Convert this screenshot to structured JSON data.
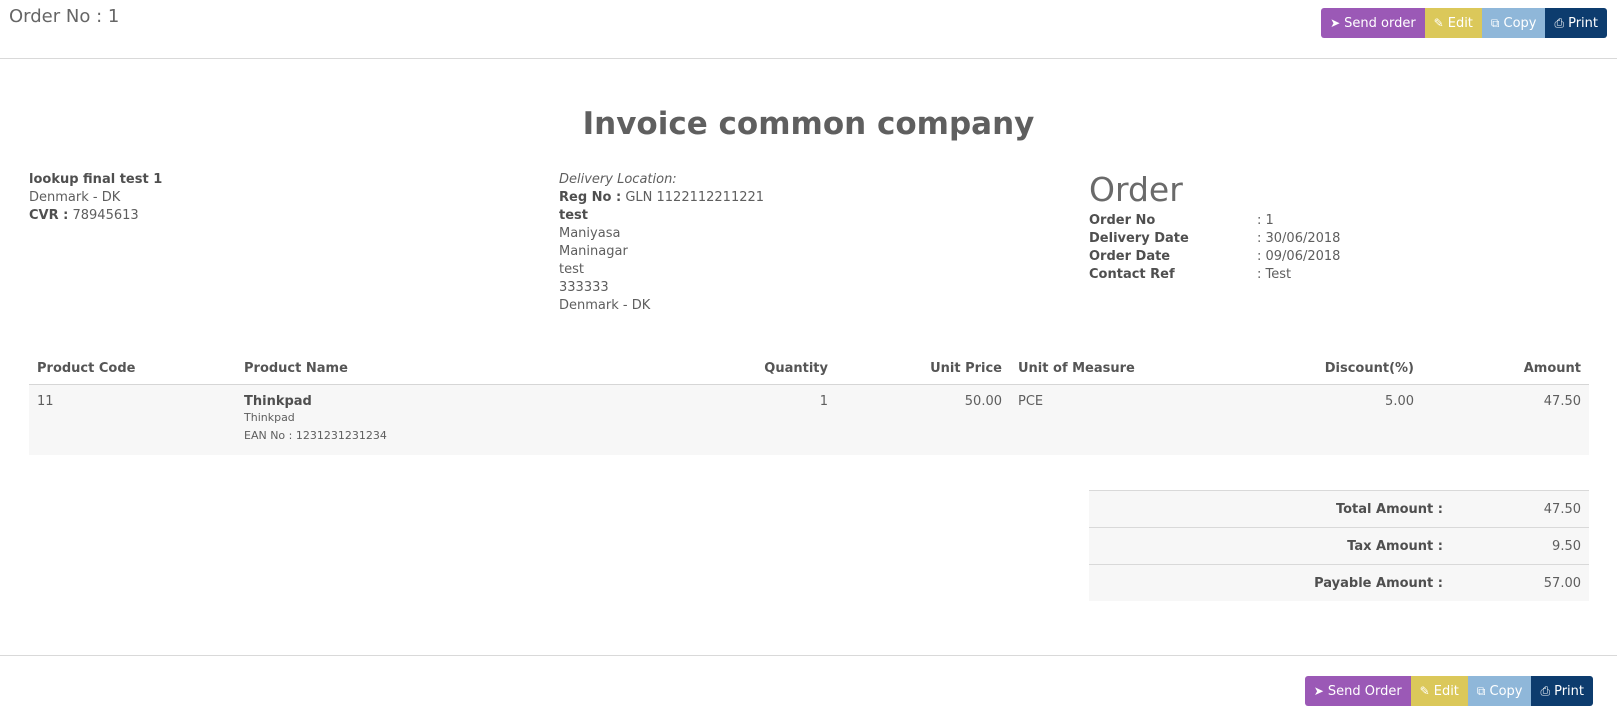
{
  "header": {
    "title": "Order No : 1",
    "buttons": {
      "send": "Send order",
      "edit": "Edit",
      "copy": "Copy",
      "print": "Print"
    }
  },
  "invoice_title": "Invoice common company",
  "customer": {
    "name": "lookup final test 1",
    "country": "Denmark - DK",
    "cvr_label": "CVR :",
    "cvr": "78945613"
  },
  "delivery": {
    "heading": "Delivery Location:",
    "reg_label": "Reg No :",
    "reg_value": "GLN 1122112211221",
    "name": "test",
    "lines": [
      "Maniyasa",
      "Maninagar",
      "test",
      "333333",
      "Denmark - DK"
    ]
  },
  "order": {
    "heading": "Order",
    "rows": [
      {
        "label": "Order No",
        "value": ": 1"
      },
      {
        "label": "Delivery Date",
        "value": ": 30/06/2018"
      },
      {
        "label": "Order Date",
        "value": ": 09/06/2018"
      },
      {
        "label": "Contact Ref",
        "value": ": Test"
      }
    ]
  },
  "table": {
    "headers": [
      "Product Code",
      "Product Name",
      "Quantity",
      "Unit Price",
      "Unit of Measure",
      "Discount(%)",
      "Amount"
    ],
    "rows": [
      {
        "code": "11",
        "name": "Thinkpad",
        "desc": "Thinkpad",
        "ean": "EAN No : 1231231231234",
        "quantity": "1",
        "unit_price": "50.00",
        "uom": "PCE",
        "discount": "5.00",
        "amount": "47.50"
      }
    ]
  },
  "totals": [
    {
      "label": "Total Amount :",
      "value": "47.50"
    },
    {
      "label": "Tax Amount :",
      "value": "9.50"
    },
    {
      "label": "Payable Amount :",
      "value": "57.00"
    }
  ],
  "footer": {
    "buttons": {
      "send": "Send Order",
      "edit": "Edit",
      "copy": "Copy",
      "print": "Print"
    }
  },
  "icons": {
    "send": "paper-plane-icon",
    "edit": "pencil-icon",
    "copy": "copy-icon",
    "print": "printer-icon"
  },
  "colors": {
    "send": "#9b59b6",
    "edit": "#dbc85a",
    "copy": "#8fb7d9",
    "print": "#0d3c6e"
  }
}
